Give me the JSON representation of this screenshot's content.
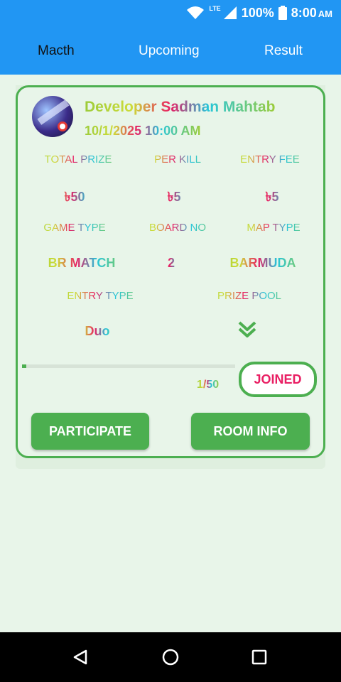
{
  "status_bar": {
    "network": "LTE",
    "battery": "100%",
    "time": "8:00",
    "ampm": "AM",
    "icons": [
      "wifi-icon",
      "signal-icon",
      "battery-icon"
    ]
  },
  "tabs": [
    {
      "label": "Macth",
      "active": true
    },
    {
      "label": "Upcoming",
      "active": false
    },
    {
      "label": "Result",
      "active": false
    }
  ],
  "card": {
    "title": "Developer Sadman Mahtab",
    "datetime": "10/1/2025 10:00 AM",
    "stats_row1": [
      {
        "label": "TOTAL PRIZE",
        "value": "৳50"
      },
      {
        "label": "PER KILL",
        "value": "৳5"
      },
      {
        "label": "ENTRY FEE",
        "value": "৳5"
      }
    ],
    "stats_row2": [
      {
        "label": "GAME TYPE",
        "value": "BR MATCH"
      },
      {
        "label": "BOARD NO",
        "value": "2"
      },
      {
        "label": "MAP TYPE",
        "value": "BARMUDA"
      }
    ],
    "stats_row3": [
      {
        "label": "ENTRY TYPE",
        "value": "Duo"
      },
      {
        "label": "PRIZE POOL",
        "icon": "double-chevron-down-icon"
      }
    ],
    "progress": {
      "joined": 1,
      "total": 50,
      "text": "1/50"
    },
    "joined_label": "JOINED",
    "participate_label": "PARTICIPATE",
    "room_info_label": "ROOM INFO"
  },
  "nav": [
    "back-icon",
    "home-icon",
    "recents-icon"
  ],
  "colors": {
    "appbar": "#2196f3",
    "accent": "#4caf50",
    "background": "#e8f5e9",
    "joined_text": "#e91e63"
  }
}
